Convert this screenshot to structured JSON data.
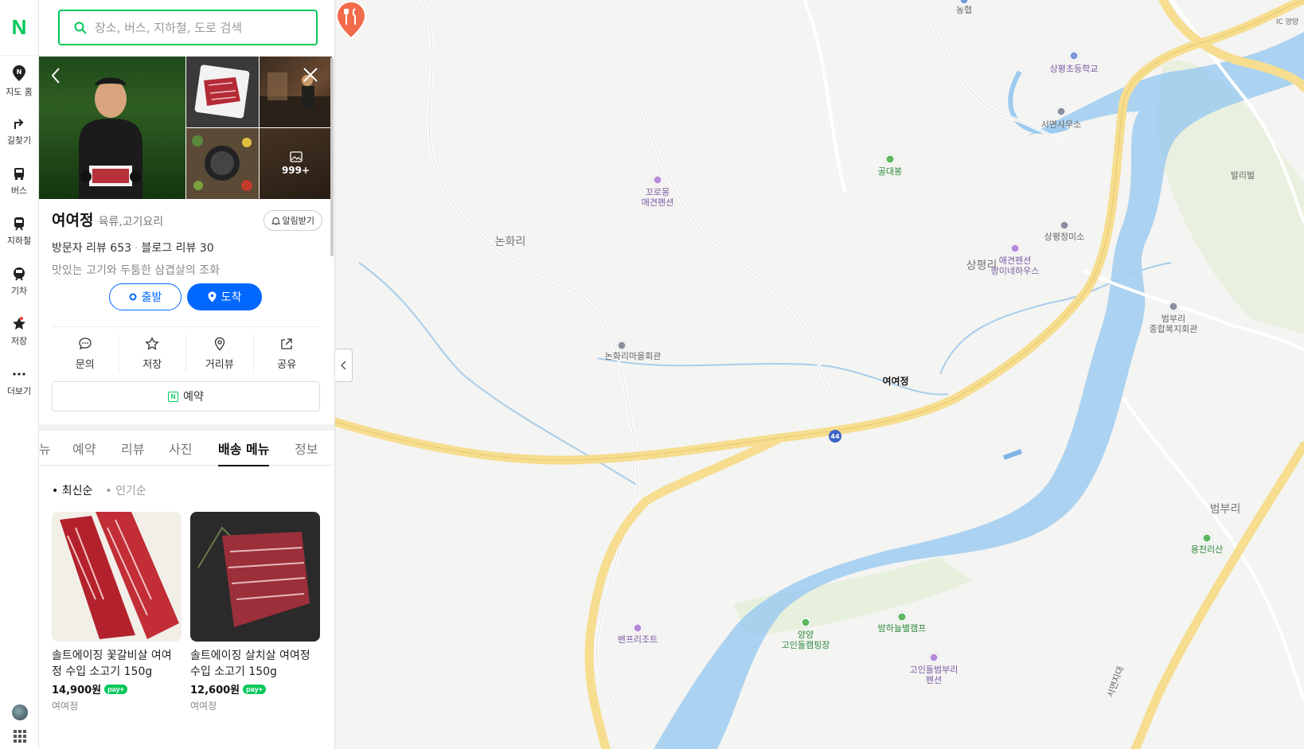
{
  "rail": {
    "logo": "N",
    "items": [
      {
        "label": "지도 홈",
        "icon": "map-home-icon"
      },
      {
        "label": "길찾기",
        "icon": "directions-icon"
      },
      {
        "label": "버스",
        "icon": "bus-icon"
      },
      {
        "label": "지하철",
        "icon": "subway-icon"
      },
      {
        "label": "기차",
        "icon": "train-icon"
      },
      {
        "label": "저장",
        "icon": "star-icon"
      },
      {
        "label": "더보기",
        "icon": "more-icon"
      }
    ]
  },
  "search": {
    "placeholder": "장소, 버스, 지하철, 도로 검색"
  },
  "place": {
    "name": "여여정",
    "category": "육류,고기요리",
    "alarm_label": "알림받기",
    "visitor_reviews": "방문자 리뷰 653",
    "blog_reviews": "블로그 리뷰 30",
    "description": "맛있는 고기와 두툼한 삼겹살의 조화",
    "photo_count": "999+"
  },
  "route": {
    "start_label": "출발",
    "end_label": "도착"
  },
  "actions": [
    {
      "label": "문의",
      "icon": "chat-icon"
    },
    {
      "label": "저장",
      "icon": "star-outline-icon"
    },
    {
      "label": "거리뷰",
      "icon": "streetview-icon"
    },
    {
      "label": "공유",
      "icon": "share-icon"
    }
  ],
  "reserve_label": "예약",
  "tabs": [
    {
      "label": "뉴",
      "active": false
    },
    {
      "label": "예약",
      "active": false
    },
    {
      "label": "리뷰",
      "active": false
    },
    {
      "label": "사진",
      "active": false
    },
    {
      "label": "배송 메뉴",
      "active": true
    },
    {
      "label": "정보",
      "active": false
    }
  ],
  "sort": {
    "latest": "최신순",
    "popular": "인기순"
  },
  "products": [
    {
      "name": "솔트에이징 꽃갈비살 여여정 수입 소고기 150g",
      "price": "14,900원",
      "pay": "pay+",
      "store": "여여정"
    },
    {
      "name": "솔트에이징 살치살 여여정 수입 소고기 150g",
      "price": "12,600원",
      "pay": "pay+",
      "store": "여여정"
    }
  ],
  "map": {
    "labels": {
      "nonghyup": "농협",
      "school": "상평초등학교",
      "office": "서면사무소",
      "golmae": "골대봉",
      "pension1": "꼬로몽\n애견펜션",
      "nonhwari": "논화리",
      "sangpyeong_shop": "상평정미소",
      "sangpyeongri": "상평리",
      "pension2": "애견펜션\n랑이네하우스",
      "beombu_hall": "범부리\n종합복지회관",
      "nonhwari_hall": "논화리마을회관",
      "pin": "여여정",
      "route44": "44",
      "beombuli": "범부리",
      "yongcheon": "용천리산",
      "benf": "밴프리조트",
      "camping1": "양양\n고인돌캠핑장",
      "camping2": "밤하늘별캠프",
      "pension3": "고인돌범부리\n펜션",
      "seomyeon_road": "서면지대",
      "balli": "발리벌",
      "ic": "IC 양양"
    }
  }
}
